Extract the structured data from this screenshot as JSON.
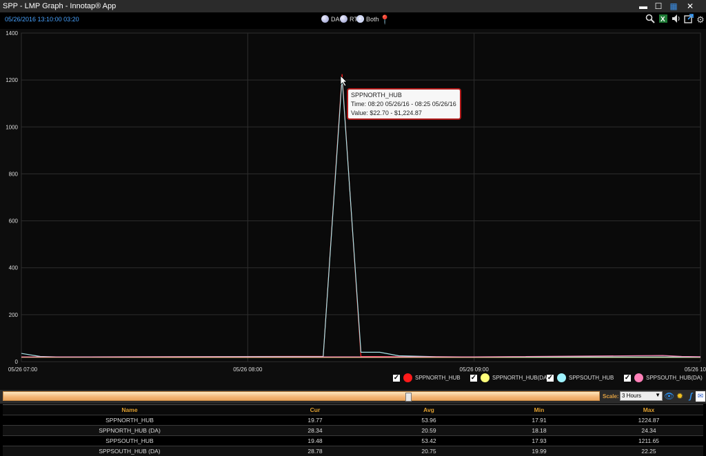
{
  "window": {
    "title": "SPP - LMP Graph - Innotap® App",
    "controls": [
      "▬",
      "☐",
      "▦",
      "✕"
    ]
  },
  "toolbar": {
    "timestamp": "05/26/2016 13:10:00  03:20",
    "modes": [
      {
        "label": "DA",
        "selected": false
      },
      {
        "label": "RT",
        "selected": false
      },
      {
        "label": "Both",
        "selected": true
      }
    ],
    "icons": [
      "search-icon",
      "excel-icon",
      "speaker-icon",
      "popout-icon",
      "gear-icon"
    ]
  },
  "tooltip": {
    "name": "SPPNORTH_HUB",
    "time": "Time: 08:20 05/26/16 - 08:25 05/26/16",
    "value": "Value: $22.70 - $1,224.87"
  },
  "chart_data": {
    "type": "line",
    "x_tick_labels": [
      "05/26 07:00",
      "05/26 08:00",
      "05/26 09:00",
      "05/26 10"
    ],
    "y_tick_labels": [
      "0",
      "200",
      "400",
      "600",
      "800",
      "1000",
      "1200",
      "1400"
    ],
    "ylim": [
      0,
      1400
    ],
    "x_range_minutes": [
      0,
      180
    ],
    "grid": true,
    "series": [
      {
        "name": "SPPNORTH_HUB",
        "color": "#ff2020",
        "x": [
          0,
          5,
          10,
          80,
          85,
          90,
          100,
          120,
          170,
          175,
          180
        ],
        "y": [
          20,
          19.8,
          19.8,
          22.7,
          1224.87,
          22,
          21,
          20,
          19.77,
          19.77,
          19.77
        ]
      },
      {
        "name": "SPPNORTH_HUB(DA)",
        "color": "#ffff80",
        "x": [
          0,
          60,
          120,
          180
        ],
        "y": [
          18.5,
          18.4,
          18.3,
          18.2
        ]
      },
      {
        "name": "SPPSOUTH_HUB",
        "color": "#a8e4e8",
        "x": [
          0,
          5,
          10,
          80,
          85,
          90,
          95,
          100,
          110,
          120,
          170,
          180
        ],
        "y": [
          35,
          22,
          20,
          22,
          1211.65,
          40,
          40,
          25,
          21,
          20,
          20,
          19.48
        ]
      },
      {
        "name": "SPPSOUTH_HUB(DA)",
        "color": "#ff88bb",
        "x": [
          0,
          60,
          120,
          170,
          175,
          180
        ],
        "y": [
          20,
          20,
          20.2,
          26,
          22,
          21
        ]
      }
    ]
  },
  "legend": [
    {
      "label": "SPPNORTH_HUB",
      "color": "#ff1a1a",
      "checked": true
    },
    {
      "label": "SPPNORTH_HUB(DA)",
      "color": "#ffff7a",
      "checked": true
    },
    {
      "label": "SPPSOUTH_HUB",
      "color": "#9ff3ff",
      "checked": true
    },
    {
      "label": "SPPSOUTH_HUB(DA)",
      "color": "#ff80b8",
      "checked": true
    }
  ],
  "scale": {
    "label": "Scale:",
    "value": "3 Hours"
  },
  "table": {
    "headers": [
      "Name",
      "Cur",
      "Avg",
      "Min",
      "Max"
    ],
    "rows": [
      [
        "SPPNORTH_HUB",
        "19.77",
        "53.96",
        "17.91",
        "1224.87"
      ],
      [
        "SPPNORTH_HUB (DA)",
        "28.34",
        "20.59",
        "18.18",
        "24.34"
      ],
      [
        "SPPSOUTH_HUB",
        "19.48",
        "53.42",
        "17.93",
        "1211.65"
      ],
      [
        "SPPSOUTH_HUB (DA)",
        "28.78",
        "20.75",
        "19.99",
        "22.25"
      ]
    ]
  }
}
